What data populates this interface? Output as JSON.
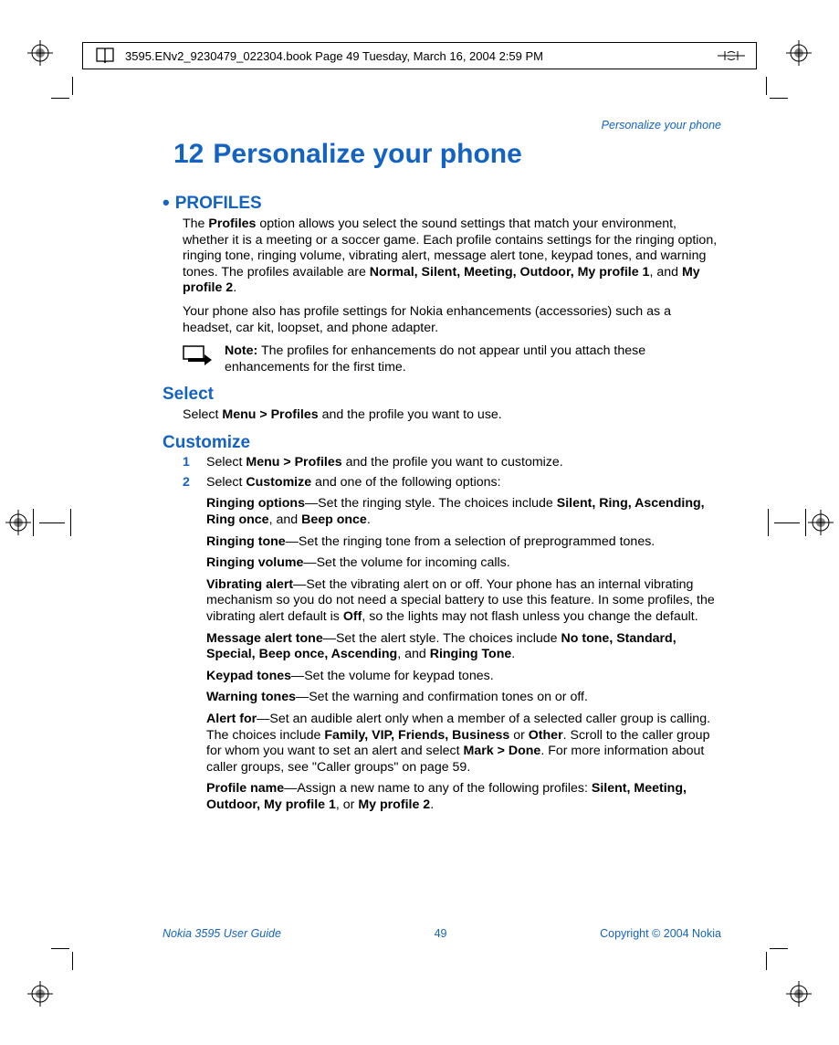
{
  "print_header": {
    "text": "3595.ENv2_9230479_022304.book  Page 49  Tuesday, March 16, 2004  2:59 PM"
  },
  "running_head": "Personalize your phone",
  "chapter": {
    "number": "12",
    "title": "Personalize your phone"
  },
  "sections": {
    "profiles": {
      "heading": "PROFILES",
      "p1_a": "The ",
      "p1_b": "Profiles",
      "p1_c": " option allows you select the sound settings that match your environment, whether it is a meeting or a soccer game. Each profile contains settings for the ringing option, ringing tone, ringing volume, vibrating alert, message alert tone, keypad tones, and warning tones. The profiles available are ",
      "p1_list": "Normal, Silent, Meeting, Outdoor, My profile 1",
      "p1_d": ", and ",
      "p1_e": "My profile 2",
      "p1_f": ".",
      "p2": "Your phone also has profile settings for Nokia enhancements (accessories) such as a headset, car kit, loopset, and phone adapter.",
      "note_label": "Note:",
      "note_text": " The profiles for enhancements do not appear until you attach these enhancements for the first time."
    },
    "select": {
      "heading": "Select",
      "p_a": "Select ",
      "p_b": "Menu > Profiles",
      "p_c": " and the profile you want to use."
    },
    "customize": {
      "heading": "Customize",
      "step1_a": "Select ",
      "step1_b": "Menu > Profiles",
      "step1_c": " and the profile you want to customize.",
      "step2_a": "Select ",
      "step2_b": "Customize",
      "step2_c": " and one of the following options:",
      "opts": {
        "o1_a": "Ringing options",
        "o1_b": "—Set the ringing style. The choices include ",
        "o1_c": "Silent, Ring, Ascending, Ring once",
        "o1_d": ", and ",
        "o1_e": "Beep once",
        "o1_f": ".",
        "o2_a": "Ringing tone",
        "o2_b": "—Set the ringing tone from a selection of preprogrammed tones.",
        "o3_a": "Ringing volume",
        "o3_b": "—Set the volume for incoming calls.",
        "o4_a": "Vibrating alert",
        "o4_b": "—Set the vibrating alert on or off. Your phone has an internal vibrating mechanism so you do not need a special battery to use this feature. In some profiles, the vibrating alert default is ",
        "o4_c": "Off",
        "o4_d": ", so the lights may not flash unless you change the default.",
        "o5_a": "Message alert tone",
        "o5_b": "—Set the alert style. The choices include ",
        "o5_c": "No tone, Standard, Special, Beep once, Ascending",
        "o5_d": ", and ",
        "o5_e": "Ringing Tone",
        "o5_f": ".",
        "o6_a": "Keypad tones",
        "o6_b": "—Set the volume for keypad tones.",
        "o7_a": "Warning tones",
        "o7_b": "—Set the warning and confirmation tones on or off.",
        "o8_a": "Alert for",
        "o8_b": "—Set an audible alert only when a member of a selected caller group is calling. The choices include ",
        "o8_c": "Family, VIP, Friends, Business",
        "o8_d": " or ",
        "o8_e": "Other",
        "o8_f": ". Scroll to the caller group for whom you want to set an alert and select ",
        "o8_g": "Mark > Done",
        "o8_h": ". For more information about caller groups, see \"Caller groups\" on page 59.",
        "o9_a": "Profile name",
        "o9_b": "—Assign a new name to any of the following profiles: ",
        "o9_c": "Silent, Meeting, Outdoor, My profile 1",
        "o9_d": ", or ",
        "o9_e": "My profile 2",
        "o9_f": "."
      }
    }
  },
  "footer": {
    "left": "Nokia 3595 User Guide",
    "center": "49",
    "right": "Copyright © 2004 Nokia"
  }
}
